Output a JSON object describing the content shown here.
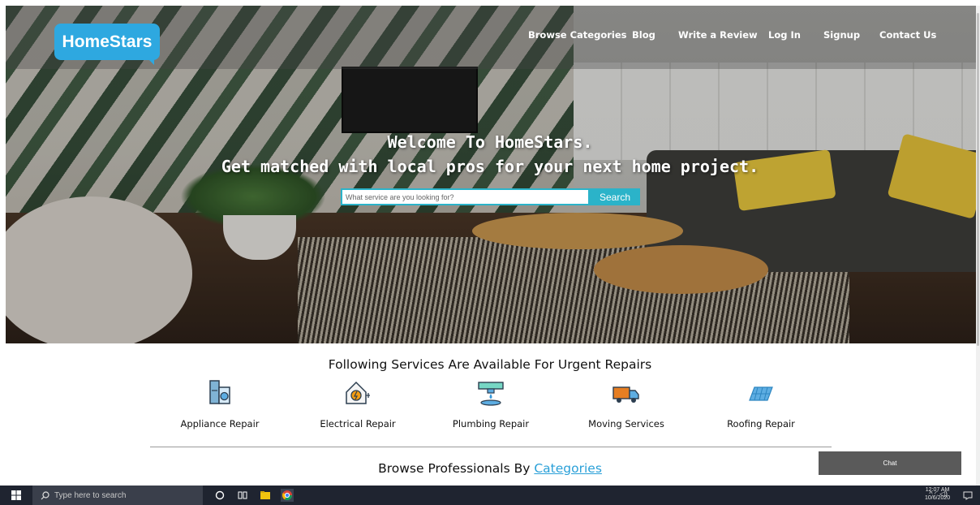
{
  "brand": {
    "name": "HomeStars",
    "color": "#2ea8e0"
  },
  "nav": {
    "items": [
      {
        "label": "Browse Categories"
      },
      {
        "label": "Blog"
      },
      {
        "label": "Write a Review"
      },
      {
        "label": "Log In"
      },
      {
        "label": "Signup"
      },
      {
        "label": "Contact Us"
      }
    ]
  },
  "hero": {
    "line1": "Welcome To HomeStars.",
    "line2": "Get matched with local pros for your next home project.",
    "search_placeholder": "What service are you looking for?",
    "search_button": "Search"
  },
  "services": {
    "heading": "Following Services Are Available For Urgent Repairs",
    "items": [
      {
        "label": "Appliance Repair",
        "icon": "appliance-icon"
      },
      {
        "label": "Electrical Repair",
        "icon": "electrical-icon"
      },
      {
        "label": "Plumbing Repair",
        "icon": "plumbing-icon"
      },
      {
        "label": "Moving Services",
        "icon": "moving-truck-icon"
      },
      {
        "label": "Roofing Repair",
        "icon": "roofing-icon"
      }
    ]
  },
  "browse": {
    "prefix": "Browse Professionals By ",
    "link": "Categories"
  },
  "chat": {
    "label": "Chat"
  },
  "taskbar": {
    "search_placeholder": "Type here to search",
    "time": "12:07 AM",
    "date": "10/6/2020"
  },
  "colors": {
    "accent": "#2bb3c9",
    "link": "#2aa0d8",
    "chat_bg": "#5a5a5a",
    "taskbar": "#1f2430"
  }
}
